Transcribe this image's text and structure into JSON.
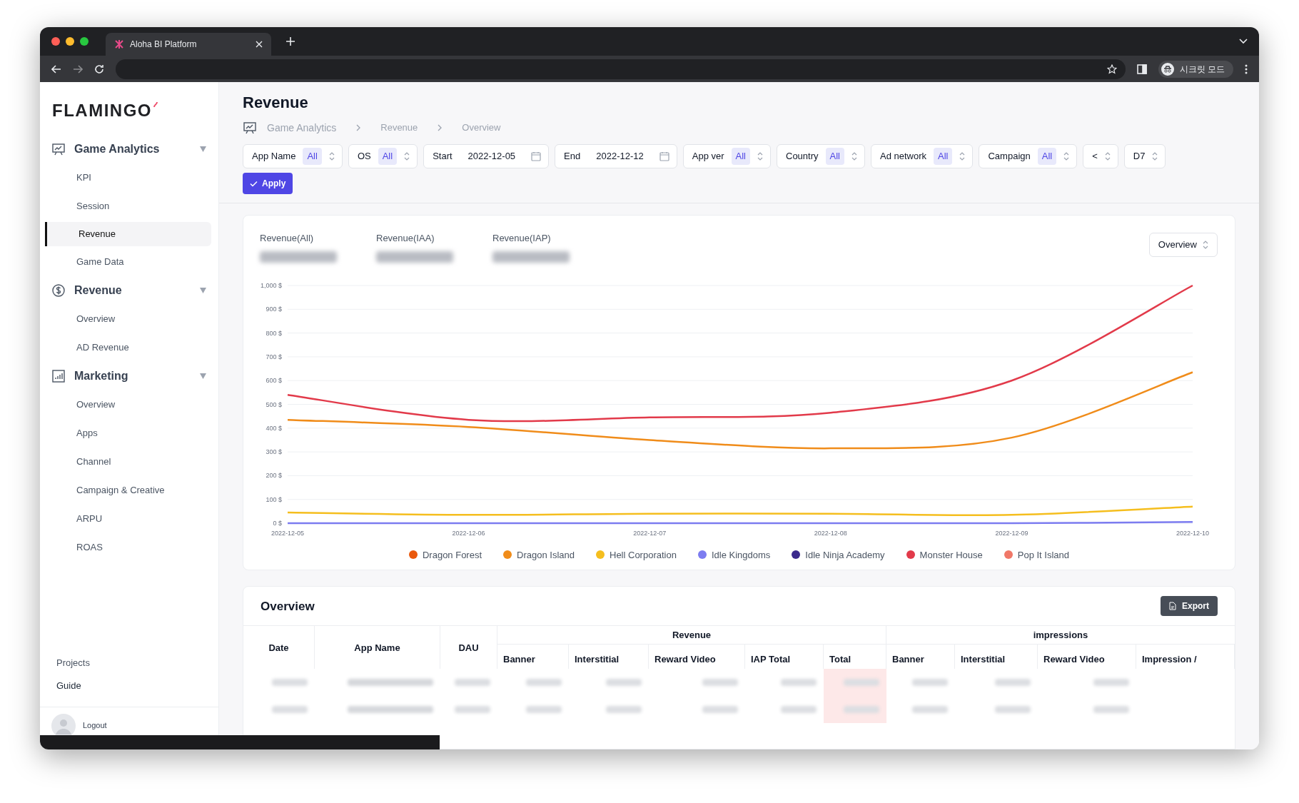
{
  "browser": {
    "tab_title": "Aloha BI Platform",
    "profile_label": "시크릿 모드"
  },
  "sidebar": {
    "logo": "FLAMINGO",
    "sections": [
      {
        "title": "Game Analytics",
        "expanded": true,
        "items": [
          {
            "label": "KPI",
            "selected": false
          },
          {
            "label": "Session",
            "selected": false
          },
          {
            "label": "Revenue",
            "selected": true
          },
          {
            "label": "Game Data",
            "selected": false
          }
        ]
      },
      {
        "title": "Revenue",
        "expanded": true,
        "items": [
          {
            "label": "Overview",
            "selected": false
          },
          {
            "label": "AD Revenue",
            "selected": false
          }
        ]
      },
      {
        "title": "Marketing",
        "expanded": true,
        "items": [
          {
            "label": "Overview",
            "selected": false
          },
          {
            "label": "Apps",
            "selected": false
          },
          {
            "label": "Channel",
            "selected": false
          },
          {
            "label": "Campaign & Creative",
            "selected": false
          },
          {
            "label": "ARPU",
            "selected": false
          },
          {
            "label": "ROAS",
            "selected": false
          }
        ]
      }
    ],
    "footer_links": [
      "Projects",
      "Guide"
    ],
    "user": {
      "logout": "Logout"
    }
  },
  "page": {
    "title": "Revenue",
    "breadcrumb": [
      "Game Analytics",
      "Revenue",
      "Overview"
    ]
  },
  "filters": [
    {
      "kind": "select",
      "label": "App Name",
      "value": "All"
    },
    {
      "kind": "select",
      "label": "OS",
      "value": "All"
    },
    {
      "kind": "date",
      "label": "Start",
      "value": "2022-12-05"
    },
    {
      "kind": "date",
      "label": "End",
      "value": "2022-12-12"
    },
    {
      "kind": "select",
      "label": "App ver",
      "value": "All"
    },
    {
      "kind": "select",
      "label": "Country",
      "value": "All"
    },
    {
      "kind": "select",
      "label": "Ad network",
      "value": "All"
    },
    {
      "kind": "select",
      "label": "Campaign",
      "value": "All"
    },
    {
      "kind": "plain",
      "value": "<"
    },
    {
      "kind": "plain",
      "value": "D7"
    }
  ],
  "apply_button": "Apply",
  "summary": {
    "metrics": [
      "Revenue(All)",
      "Revenue(IAA)",
      "Revenue(IAP)"
    ],
    "view_select": "Overview",
    "chart_data": {
      "type": "line",
      "categories": [
        "2022-12-05",
        "2022-12-06",
        "2022-12-07",
        "2022-12-08",
        "2022-12-09",
        "2022-12-10"
      ],
      "ylim": [
        0,
        1000
      ],
      "grid": true,
      "yticks": [
        {
          "value": 0,
          "label": "0 $"
        },
        {
          "value": 100,
          "label": "100 $"
        },
        {
          "value": 200,
          "label": "200 $"
        },
        {
          "value": 300,
          "label": "300 $"
        },
        {
          "value": 400,
          "label": "400 $"
        },
        {
          "value": 500,
          "label": "500 $"
        },
        {
          "value": 600,
          "label": "600 $"
        },
        {
          "value": 700,
          "label": "700 $"
        },
        {
          "value": 800,
          "label": "800 $"
        },
        {
          "value": 900,
          "label": "900 $"
        },
        {
          "value": 1000,
          "label": "1,000 $"
        }
      ],
      "series": [
        {
          "name": "Dragon Forest",
          "color": "#ea580c",
          "values": [
            null,
            null,
            null,
            null,
            null,
            null
          ]
        },
        {
          "name": "Dragon Island",
          "color": "#f08c1a",
          "values": [
            435,
            405,
            350,
            315,
            360,
            635
          ]
        },
        {
          "name": "Hell Corporation",
          "color": "#f5be1e",
          "values": [
            45,
            35,
            40,
            40,
            35,
            70
          ]
        },
        {
          "name": "Idle Kingdoms",
          "color": "#7c7cf0",
          "values": [
            0,
            0,
            0,
            0,
            0,
            5
          ]
        },
        {
          "name": "Idle Ninja Academy",
          "color": "#3b2a8c",
          "values": [
            null,
            null,
            null,
            null,
            null,
            null
          ]
        },
        {
          "name": "Monster House",
          "color": "#e23a4a",
          "values": [
            540,
            435,
            445,
            465,
            600,
            1000
          ]
        },
        {
          "name": "Pop It Island",
          "color": "#f07868",
          "values": [
            null,
            null,
            null,
            null,
            null,
            null
          ]
        }
      ]
    }
  },
  "overview": {
    "title": "Overview",
    "export_button": "Export",
    "columns": [
      {
        "label": "Date"
      },
      {
        "label": "App Name"
      },
      {
        "label": "DAU"
      }
    ],
    "groups": [
      {
        "label": "Revenue",
        "columns": [
          "Banner",
          "Interstitial",
          "Reward Video",
          "IAP Total",
          "Total"
        ]
      },
      {
        "label": "impressions",
        "columns": [
          "Banner",
          "Interstitial",
          "Reward Video",
          "Impression /"
        ]
      }
    ]
  }
}
